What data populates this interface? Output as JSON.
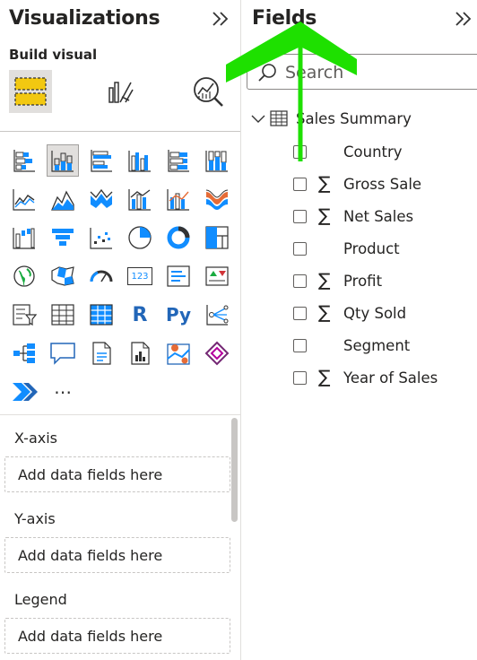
{
  "visualizations": {
    "title": "Visualizations",
    "build_visual_label": "Build visual",
    "tabs": [
      {
        "icon": "build-visual-icon",
        "selected": true
      },
      {
        "icon": "format-visual-icon",
        "selected": false
      },
      {
        "icon": "analytics-icon",
        "selected": false
      }
    ],
    "more_label": "⋯",
    "r_label": "R",
    "py_label": "Py",
    "kpi_label": "123",
    "wells": [
      {
        "label": "X-axis",
        "placeholder": "Add data fields here"
      },
      {
        "label": "Y-axis",
        "placeholder": "Add data fields here"
      },
      {
        "label": "Legend",
        "placeholder": "Add data fields here"
      }
    ]
  },
  "fields": {
    "title": "Fields",
    "search_placeholder": "Search",
    "table": {
      "name": "Sales Summary",
      "items": [
        {
          "name": "Country",
          "sigma": false
        },
        {
          "name": "Gross Sale",
          "sigma": true
        },
        {
          "name": "Net Sales",
          "sigma": true
        },
        {
          "name": "Product",
          "sigma": false
        },
        {
          "name": "Profit",
          "sigma": true
        },
        {
          "name": "Qty Sold",
          "sigma": true
        },
        {
          "name": "Segment",
          "sigma": false
        },
        {
          "name": "Year of Sales",
          "sigma": true
        }
      ]
    }
  },
  "colors": {
    "accent_yellow": "#f2c811",
    "accent_blue": "#118dff",
    "annotation_green": "#1ee000",
    "text": "#252423"
  }
}
